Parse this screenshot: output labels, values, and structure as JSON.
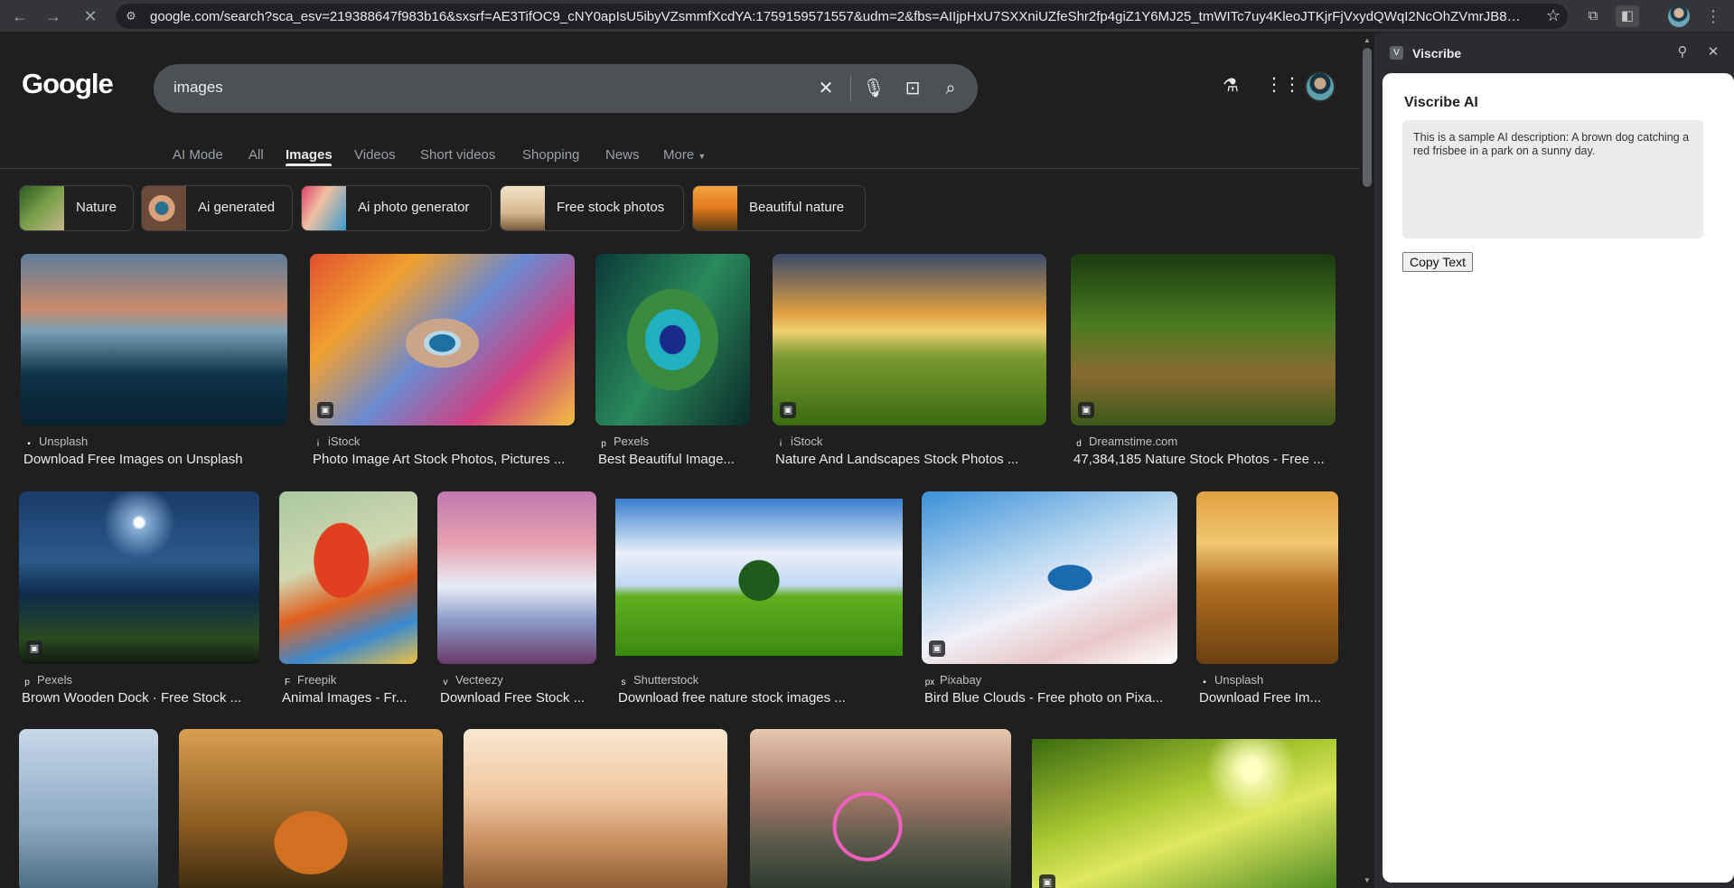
{
  "browser": {
    "url": "google.com/search?sca_esv=219388647f983b16&sxsrf=AE3TifOC9_cNY0apIsU5ibyVZsmmfXcdYA:1759159571557&udm=2&fbs=AIIjpHxU7SXXniUZfeShr2fp4giZ1Y6MJ25_tmWITc7uy4KleoJTKjrFjVxydQWqI2NcOhZVmrJB8DQUK5Izx...",
    "icons": [
      "back-icon",
      "forward-icon",
      "stop-icon",
      "site-info-icon",
      "star-icon",
      "extensions-icon",
      "side-panel-icon",
      "profile-icon",
      "menu-icon"
    ]
  },
  "google": {
    "logo": "Google",
    "query": "images",
    "tabs": [
      "AI Mode",
      "All",
      "Images",
      "Videos",
      "Short videos",
      "Shopping",
      "News",
      "More"
    ],
    "active_tab": "Images",
    "chips": [
      "Nature",
      "Ai generated",
      "Ai photo generator",
      "Free stock photos",
      "Beautiful nature"
    ],
    "row1": [
      {
        "source": "Unsplash",
        "title": "Download Free Images on Unsplash"
      },
      {
        "source": "iStock",
        "title": "Photo Image Art Stock Photos, Pictures ..."
      },
      {
        "source": "Pexels",
        "title": "Best Beautiful Image..."
      },
      {
        "source": "iStock",
        "title": "Nature And Landscapes Stock Photos ..."
      },
      {
        "source": "Dreamstime.com",
        "title": "47,384,185 Nature Stock Photos - Free ..."
      }
    ],
    "row2": [
      {
        "source": "Pexels",
        "title": "Brown Wooden Dock · Free Stock ..."
      },
      {
        "source": "Freepik",
        "title": "Animal Images - Fr..."
      },
      {
        "source": "Vecteezy",
        "title": "Download Free Stock ..."
      },
      {
        "source": "Shutterstock",
        "title": "Download free nature stock images ..."
      },
      {
        "source": "Pixabay",
        "title": "Bird Blue Clouds - Free photo on Pixa..."
      },
      {
        "source": "Unsplash",
        "title": "Download Free Im..."
      }
    ]
  },
  "panel": {
    "name": "Viscribe",
    "heading": "Viscribe AI",
    "description": "This is a sample AI description: A brown dog catching a red frisbee in a park on a sunny day.",
    "copy_label": "Copy Text"
  }
}
